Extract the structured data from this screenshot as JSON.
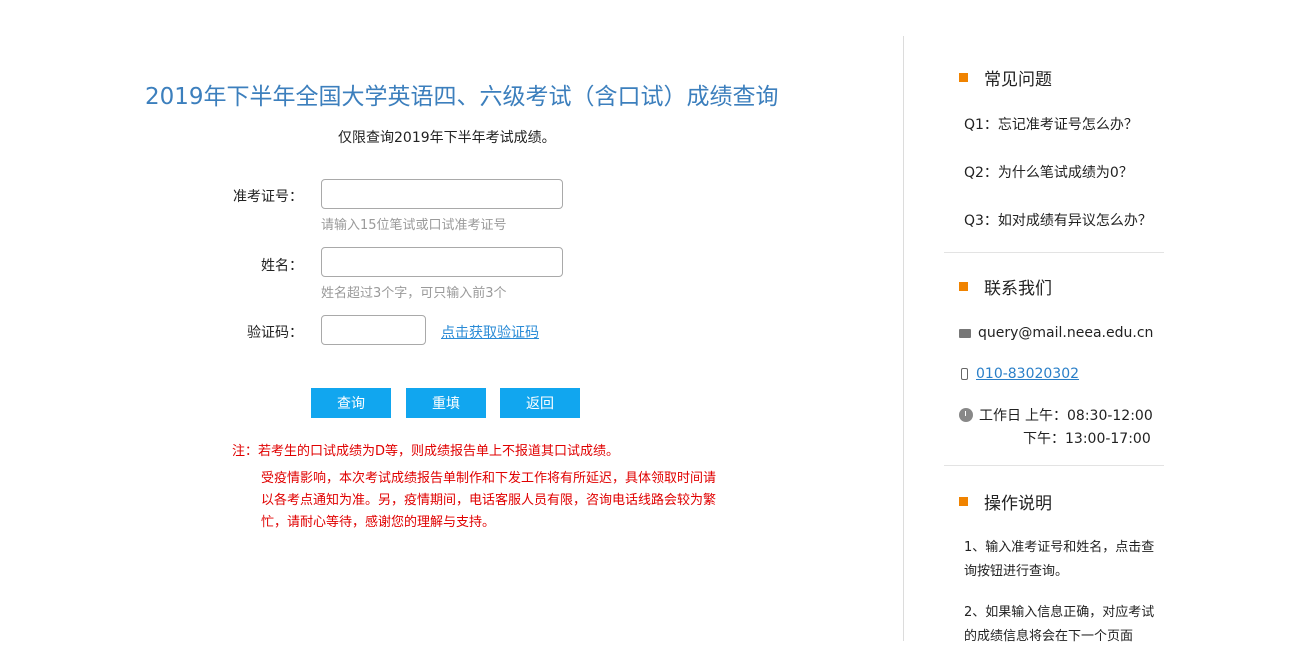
{
  "main": {
    "title": "2019年下半年全国大学英语四、六级考试（含口试）成绩查询",
    "subtitle": "仅限查询2019年下半年考试成绩。",
    "form": {
      "ticket_label": "准考证号：",
      "ticket_value": "",
      "ticket_hint": "请输入15位笔试或口试准考证号",
      "name_label": "姓名：",
      "name_value": "",
      "name_hint": "姓名超过3个字，可只输入前3个",
      "captcha_label": "验证码：",
      "captcha_value": "",
      "captcha_link": "点击获取验证码"
    },
    "buttons": {
      "query": "查询",
      "reset": "重填",
      "back": "返回"
    },
    "note_primary": "注：若考生的口试成绩为D等，则成绩报告单上不报道其口试成绩。",
    "note_secondary": "受疫情影响，本次考试成绩报告单制作和下发工作将有所延迟，具体领取时间请以各考点通知为准。另，疫情期间，电话客服人员有限，咨询电话线路会较为繁忙，请耐心等待，感谢您的理解与支持。"
  },
  "sidebar": {
    "faq": {
      "title": "常见问题",
      "items": [
        "Q1：忘记准考证号怎么办？",
        "Q2：为什么笔试成绩为0？",
        "Q3：如对成绩有异议怎么办？"
      ]
    },
    "contact": {
      "title": "联系我们",
      "email": "query@mail.neea.edu.cn",
      "phone": "010-83020302",
      "hours_label": "工作日",
      "hours_am": "上午：08:30-12:00",
      "hours_pm": "下午：13:00-17:00"
    },
    "instructions": {
      "title": "操作说明",
      "step1": "1、输入准考证号和姓名，点击查询按钮进行查询。",
      "step2": "2、如果输入信息正确，对应考试的成绩信息将会在下一个页面"
    }
  },
  "colors": {
    "title_blue": "#3c7fbd",
    "button_blue": "#11a6ef",
    "note_red": "#e00000",
    "accent_orange": "#f08300"
  }
}
